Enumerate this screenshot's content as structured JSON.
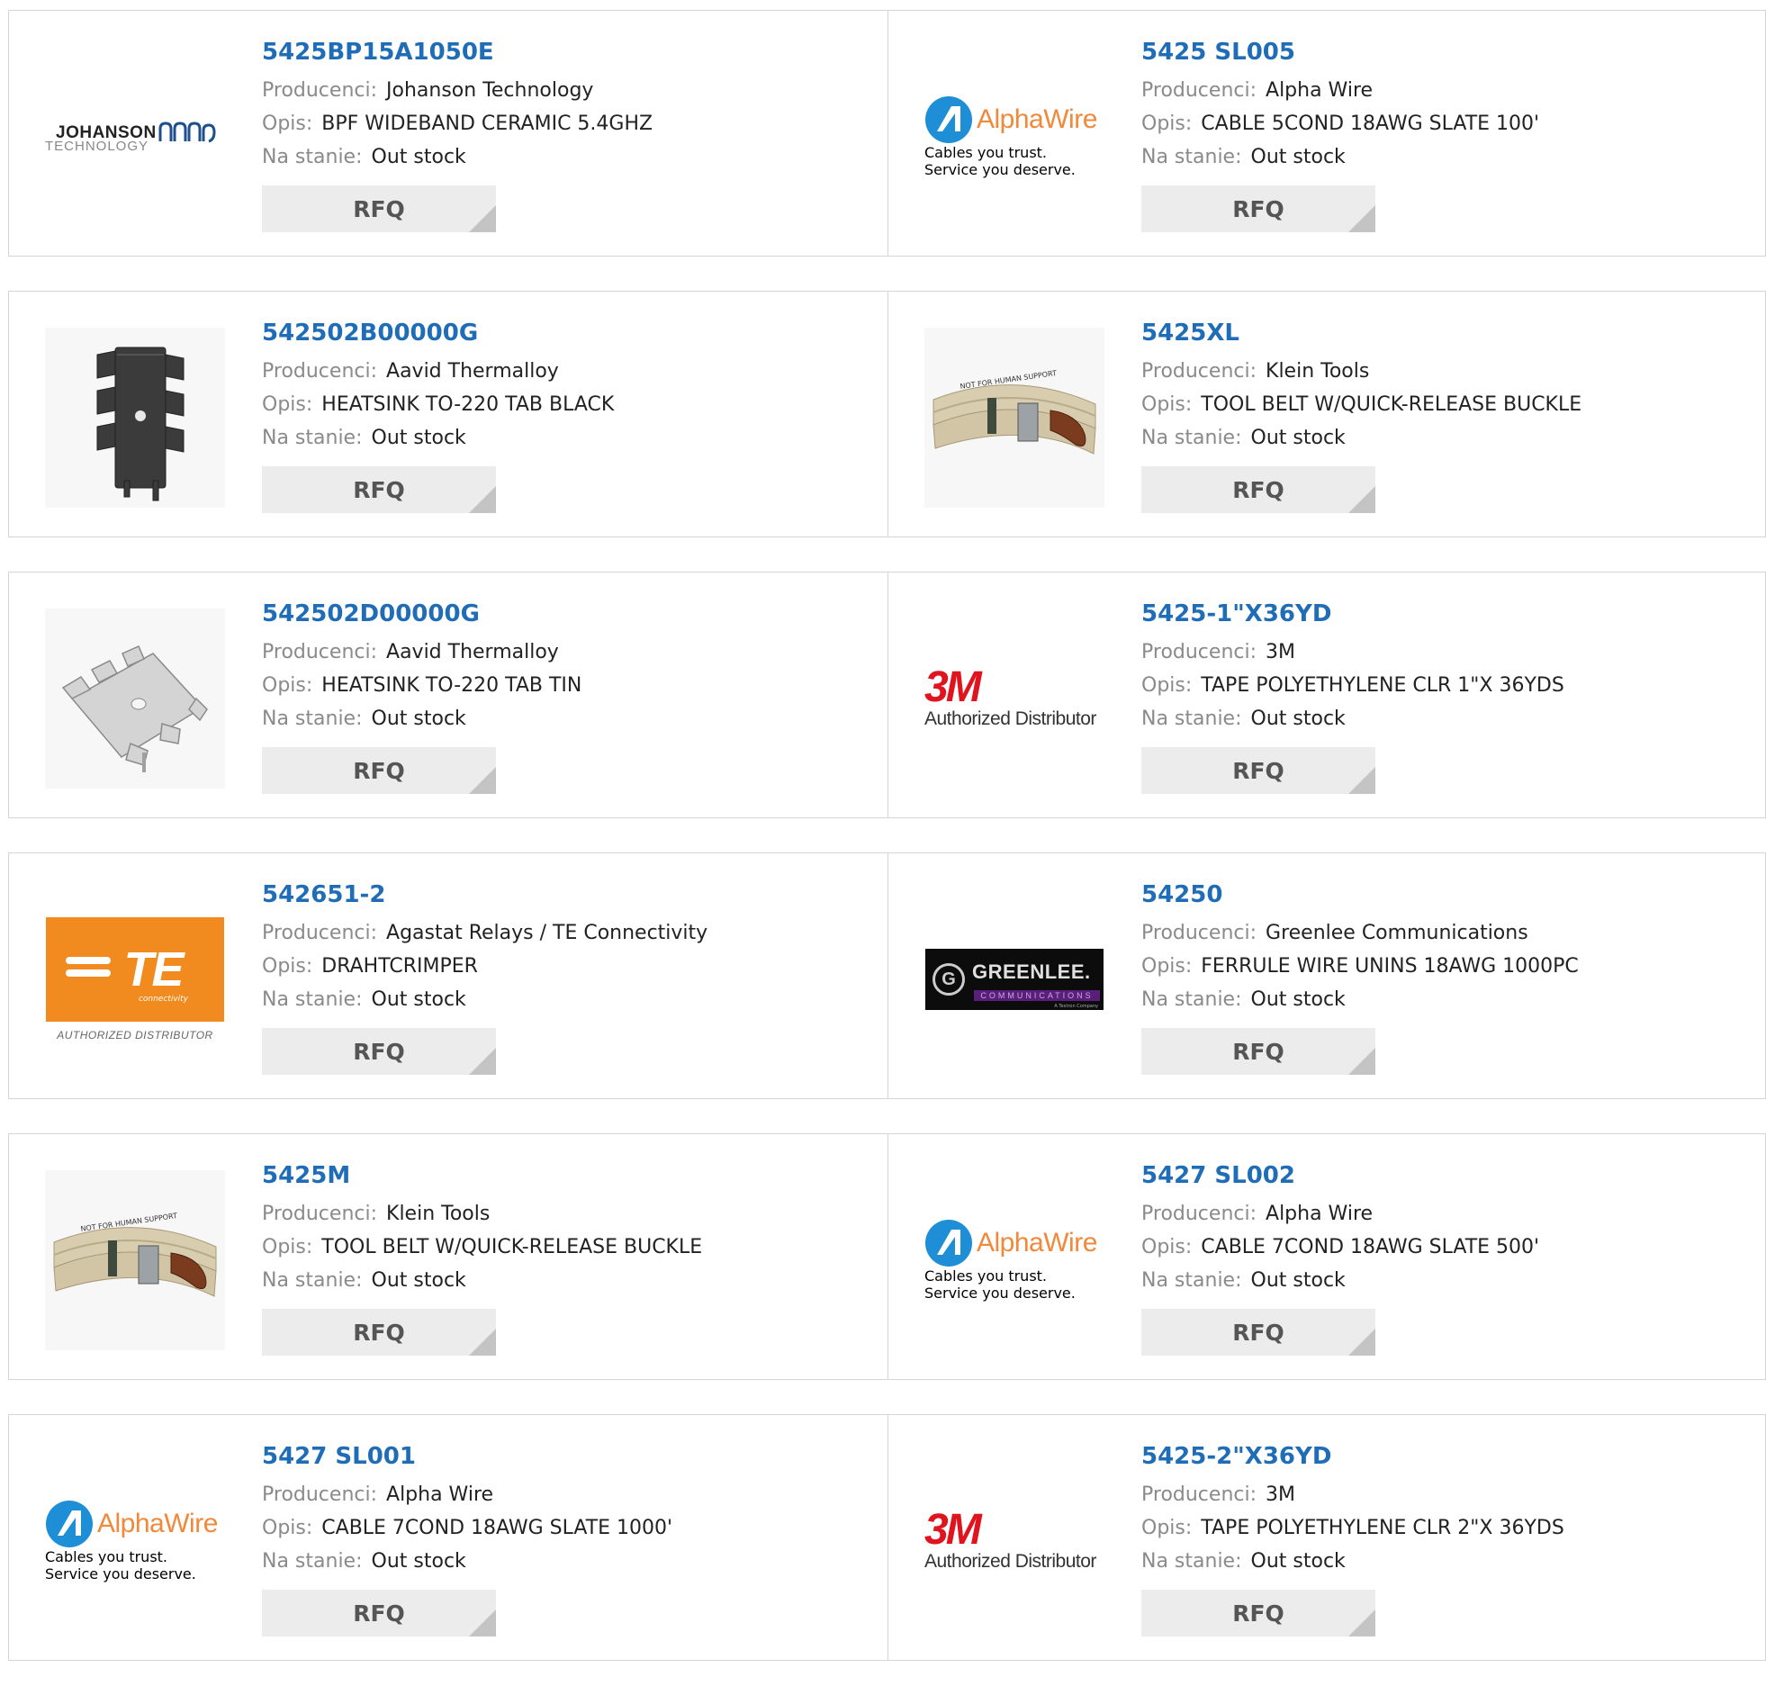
{
  "labels": {
    "manufacturer": "Producenci:",
    "description": "Opis:",
    "stock": "Na stanie:",
    "rfq": "RFQ"
  },
  "logo_text": {
    "johanson_1": "JOHANSON",
    "johanson_2": "TECHNOLOGY",
    "alpha": "AlphaWire",
    "alpha_tagline": "Cables you trust. Service you deserve.",
    "m3": "3M",
    "authorized": "Authorized Distributor",
    "te": "TE",
    "te_connectivity": "connectivity",
    "te_authorized": "AUTHORIZED DISTRIBUTOR",
    "greenlee_g": "G",
    "greenlee": "GREENLEE.",
    "greenlee_comm": "COMMUNICATIONS",
    "greenlee_sub": "A Textron Company",
    "belt_print": "NOT FOR HUMAN SUPPORT"
  },
  "colors": {
    "title_link": "#1f6db7",
    "label_gray": "#8a8a8a",
    "rfq_bg": "#ececec",
    "te_orange": "#f28b1f",
    "alpha_orange": "#f2883a",
    "alpha_blue": "#1e8fd6",
    "m3_red": "#e0141e"
  },
  "products": [
    {
      "part": "5425BP15A1050E",
      "manufacturer": "Johanson Technology",
      "description": "BPF WIDEBAND CERAMIC 5.4GHZ",
      "stock": "Out stock",
      "image": "johanson-logo"
    },
    {
      "part": "5425 SL005",
      "manufacturer": "Alpha Wire",
      "description": "CABLE 5COND 18AWG SLATE 100'",
      "stock": "Out stock",
      "image": "alphawire-logo"
    },
    {
      "part": "542502B00000G",
      "manufacturer": "Aavid Thermalloy",
      "description": "HEATSINK TO-220 TAB BLACK",
      "stock": "Out stock",
      "image": "heatsink-black-image"
    },
    {
      "part": "5425XL",
      "manufacturer": "Klein Tools",
      "description": "TOOL BELT W/QUICK-RELEASE BUCKLE",
      "stock": "Out stock",
      "image": "tool-belt-image"
    },
    {
      "part": "542502D00000G",
      "manufacturer": "Aavid Thermalloy",
      "description": "HEATSINK TO-220 TAB TIN",
      "stock": "Out stock",
      "image": "heatsink-tin-image"
    },
    {
      "part": "5425-1\"X36YD",
      "manufacturer": "3M",
      "description": "TAPE POLYETHYLENE CLR 1\"X 36YDS",
      "stock": "Out stock",
      "image": "3m-logo"
    },
    {
      "part": "542651-2",
      "manufacturer": "Agastat Relays / TE Connectivity",
      "description": "DRAHTCRIMPER",
      "stock": "Out stock",
      "image": "te-logo"
    },
    {
      "part": "54250",
      "manufacturer": "Greenlee Communications",
      "description": "FERRULE WIRE UNINS 18AWG 1000PC",
      "stock": "Out stock",
      "image": "greenlee-logo"
    },
    {
      "part": "5425M",
      "manufacturer": "Klein Tools",
      "description": "TOOL BELT W/QUICK-RELEASE BUCKLE",
      "stock": "Out stock",
      "image": "tool-belt-image"
    },
    {
      "part": "5427 SL002",
      "manufacturer": "Alpha Wire",
      "description": "CABLE 7COND 18AWG SLATE 500'",
      "stock": "Out stock",
      "image": "alphawire-logo"
    },
    {
      "part": "5427 SL001",
      "manufacturer": "Alpha Wire",
      "description": "CABLE 7COND 18AWG SLATE 1000'",
      "stock": "Out stock",
      "image": "alphawire-logo"
    },
    {
      "part": "5425-2\"X36YD",
      "manufacturer": "3M",
      "description": "TAPE POLYETHYLENE CLR 2\"X 36YDS",
      "stock": "Out stock",
      "image": "3m-logo"
    }
  ]
}
